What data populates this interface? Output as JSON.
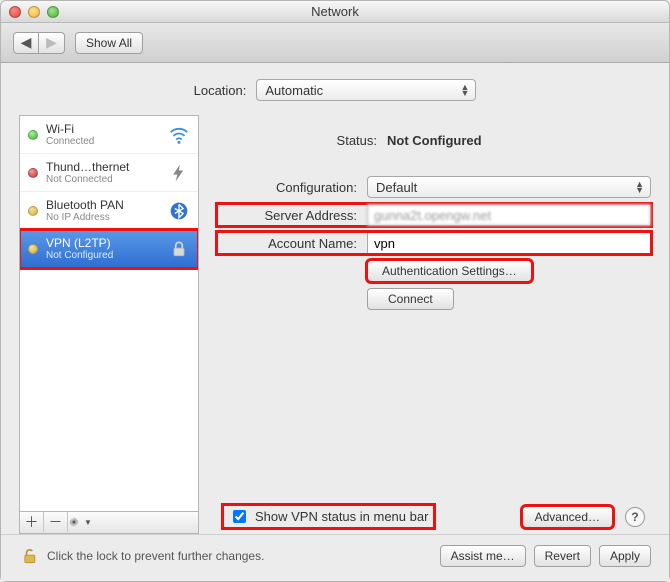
{
  "window": {
    "title": "Network"
  },
  "toolbar": {
    "show_all_label": "Show All"
  },
  "location": {
    "label": "Location:",
    "value": "Automatic"
  },
  "sidebar": {
    "items": [
      {
        "name": "Wi-Fi",
        "status": "Connected",
        "dot": "green",
        "icon": "wifi"
      },
      {
        "name": "Thund…thernet",
        "status": "Not Connected",
        "dot": "red",
        "icon": "thunderbolt"
      },
      {
        "name": "Bluetooth PAN",
        "status": "No IP Address",
        "dot": "yellow",
        "icon": "bluetooth"
      },
      {
        "name": "VPN (L2TP)",
        "status": "Not Configured",
        "dot": "yellow",
        "icon": "lock",
        "selected": true
      }
    ]
  },
  "detail": {
    "status_label": "Status:",
    "status_value": "Not Configured",
    "configuration_label": "Configuration:",
    "configuration_value": "Default",
    "server_address_label": "Server Address:",
    "server_address_value": "gunna2t.opengw.net",
    "account_name_label": "Account Name:",
    "account_name_value": "vpn",
    "auth_settings_label": "Authentication Settings…",
    "connect_label": "Connect",
    "show_status_label": "Show VPN status in menu bar",
    "show_status_checked": true,
    "advanced_label": "Advanced…"
  },
  "footer": {
    "lock_text": "Click the lock to prevent further changes.",
    "assist_label": "Assist me…",
    "revert_label": "Revert",
    "apply_label": "Apply"
  }
}
